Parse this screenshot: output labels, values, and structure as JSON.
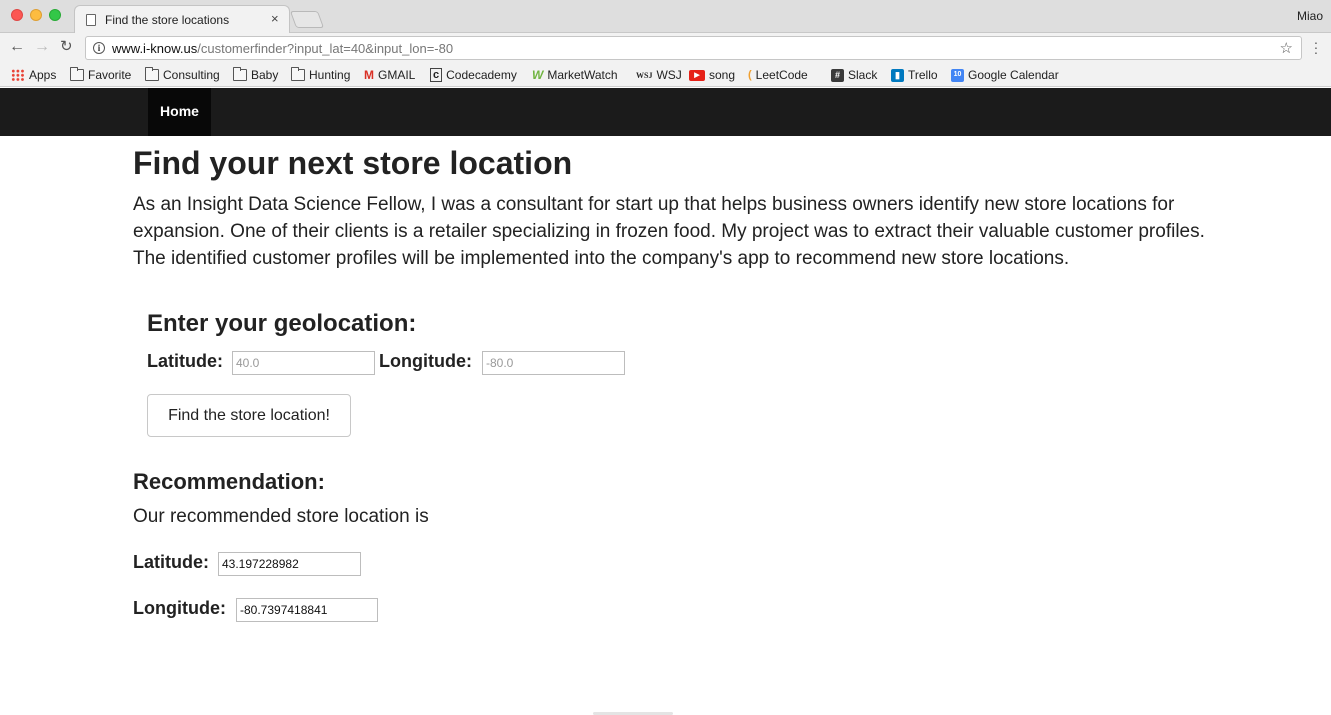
{
  "browser": {
    "tab_title": "Find the store locations",
    "tab_close": "×",
    "profile_name": "Miao",
    "url_host": "www.i-know.us",
    "url_path": "/customerfinder?input_lat=40&input_lon=-80",
    "bookmarks": [
      {
        "label": "Apps",
        "icon": "apps-grid-icon"
      },
      {
        "label": "Favorite",
        "icon": "folder-icon"
      },
      {
        "label": "Consulting",
        "icon": "folder-icon"
      },
      {
        "label": "Baby",
        "icon": "folder-icon"
      },
      {
        "label": "Hunting",
        "icon": "folder-icon"
      },
      {
        "label": "GMAIL",
        "icon": "gmail-icon"
      },
      {
        "label": "Codecademy",
        "icon": "codecademy-icon"
      },
      {
        "label": "MarketWatch",
        "icon": "marketwatch-icon"
      },
      {
        "label": "WSJ",
        "icon": "wsj-icon"
      },
      {
        "label": "song",
        "icon": "youtube-icon"
      },
      {
        "label": "LeetCode",
        "icon": "leetcode-icon"
      },
      {
        "label": "Slack",
        "icon": "slack-icon"
      },
      {
        "label": "Trello",
        "icon": "trello-icon"
      },
      {
        "label": "Google Calendar",
        "icon": "calendar-icon"
      }
    ]
  },
  "site": {
    "nav_home": "Home",
    "title": "Find your next store location",
    "intro": "As an Insight Data Science Fellow, I was a consultant for start up that helps business owners identify new store locations for expansion. One of their clients is a retailer specializing in frozen food. My project was to extract their valuable customer profiles. The identified customer profiles will be implemented into the company's app to recommend new store locations.",
    "form": {
      "heading": "Enter your geolocation:",
      "lat_label": "Latitude:",
      "lat_placeholder": "40.0",
      "lon_label": "Longitude:",
      "lon_placeholder": "-80.0",
      "submit_label": "Find the store location!"
    },
    "recommendation": {
      "heading": "Recommendation:",
      "text": "Our recommended store location is",
      "lat_label": "Latitude:",
      "lat_value": "43.197228982",
      "lon_label": "Longitude:",
      "lon_value": "-80.7397418841"
    }
  },
  "colors": {
    "navbar": "#1b1b1b",
    "navbar_active": "#080808",
    "gmail_red": "#d93025",
    "youtube_red": "#e62117",
    "trello_blue": "#0079bf",
    "calendar_blue": "#4285f4",
    "marketwatch_green": "#6fb43f"
  }
}
